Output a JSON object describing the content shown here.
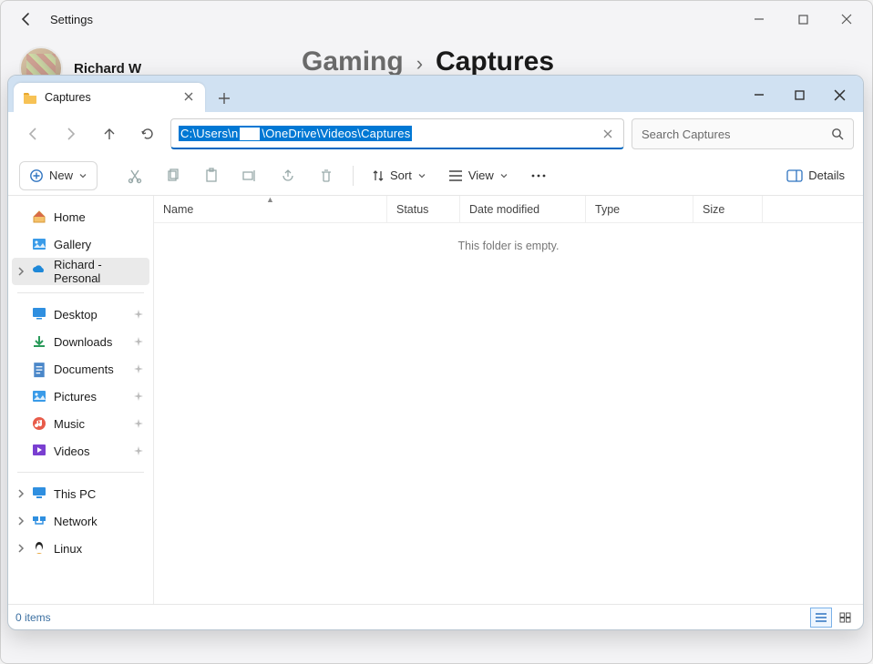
{
  "settings": {
    "title": "Settings",
    "user_name": "Richard W",
    "breadcrumb": {
      "gaming": "Gaming",
      "sep": "›",
      "captures": "Captures"
    }
  },
  "explorer": {
    "tab_title": "Captures",
    "address_prefix": "C:\\Users\\n",
    "address_suffix": "\\OneDrive\\Videos\\Captures",
    "search_placeholder": "Search Captures",
    "toolbar": {
      "new": "New",
      "sort": "Sort",
      "view": "View",
      "details": "Details"
    },
    "sidebar": {
      "home": "Home",
      "gallery": "Gallery",
      "personal": "Richard - Personal",
      "desktop": "Desktop",
      "downloads": "Downloads",
      "documents": "Documents",
      "pictures": "Pictures",
      "music": "Music",
      "videos": "Videos",
      "thispc": "This PC",
      "network": "Network",
      "linux": "Linux"
    },
    "columns": {
      "name": "Name",
      "status": "Status",
      "date": "Date modified",
      "type": "Type",
      "size": "Size"
    },
    "empty_text": "This folder is empty.",
    "status_items": "0 items"
  }
}
